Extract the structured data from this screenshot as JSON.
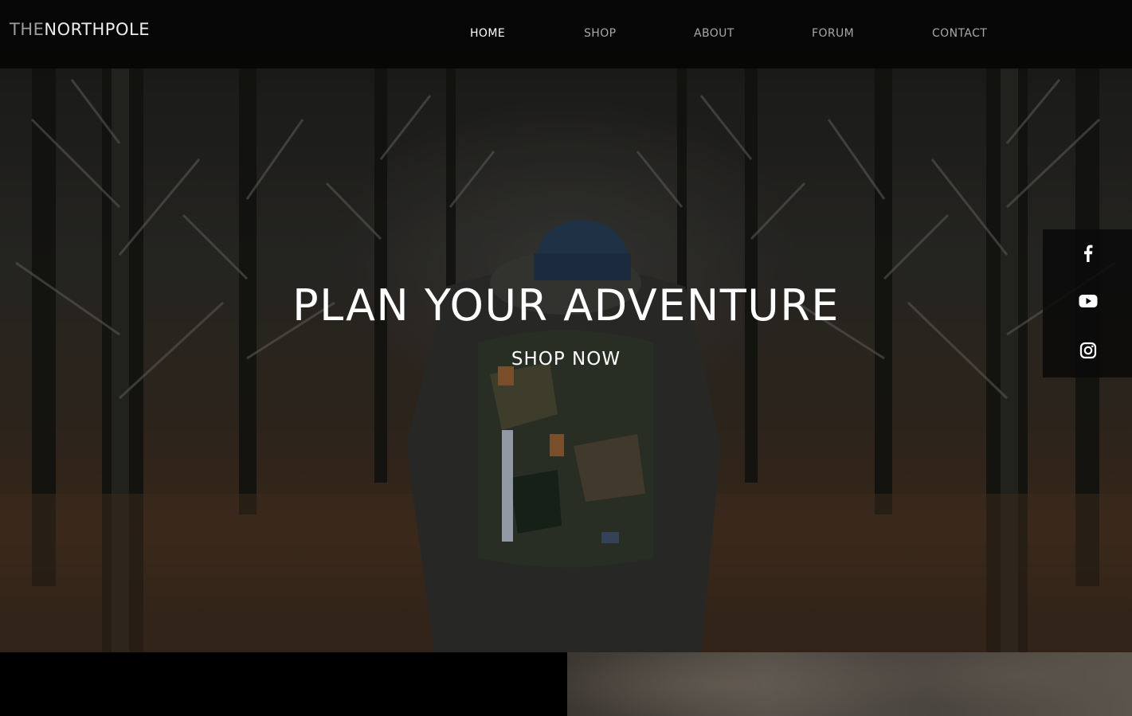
{
  "brand": {
    "prefix": "THE",
    "name": "NORTHPOLE"
  },
  "nav": {
    "items": [
      {
        "label": "HOME",
        "active": true
      },
      {
        "label": "SHOP",
        "active": false
      },
      {
        "label": "ABOUT",
        "active": false
      },
      {
        "label": "FORUM",
        "active": false
      },
      {
        "label": "CONTACT",
        "active": false
      }
    ]
  },
  "hero": {
    "title": "PLAN YOUR ADVENTURE",
    "cta_label": "SHOP NOW"
  },
  "social": {
    "icons": [
      "facebook-icon",
      "youtube-icon",
      "instagram-icon"
    ]
  },
  "colors": {
    "nav_active": "#ffffff",
    "nav_inactive": "#a8a8a8",
    "hero_text": "#ffffff"
  }
}
